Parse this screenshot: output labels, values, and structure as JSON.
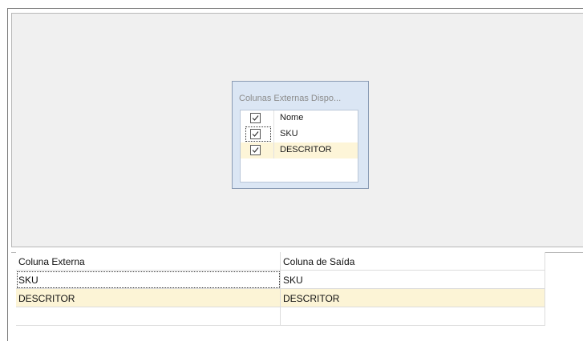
{
  "dialog": {
    "title": "Colunas Externas Dispo...",
    "header_label": "Nome",
    "rows": [
      {
        "label": "SKU",
        "checked": true
      },
      {
        "label": "DESCRITOR",
        "checked": true
      }
    ]
  },
  "grid": {
    "columns": [
      "Coluna Externa",
      "Coluna de Saída"
    ],
    "rows": [
      [
        "SKU",
        "SKU"
      ],
      [
        "DESCRITOR",
        "DESCRITOR"
      ]
    ]
  },
  "colors": {
    "selection": "#fcf4d6",
    "canvas": "#f0f0f0",
    "dialog_bg": "#dbe6f4"
  }
}
